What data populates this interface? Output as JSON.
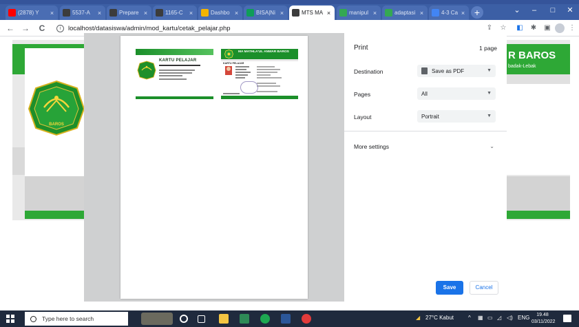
{
  "browser": {
    "tabs": [
      {
        "title": "(2878) Y",
        "favicon_color": "#ff0000",
        "active": false
      },
      {
        "title": "5537-A",
        "favicon_color": "#3c3c3c",
        "active": false
      },
      {
        "title": "Prepare",
        "favicon_color": "#3c3c3c",
        "active": false
      },
      {
        "title": "1165-C",
        "favicon_color": "#3c3c3c",
        "active": false
      },
      {
        "title": "Dashbo",
        "favicon_color": "#f4b400",
        "active": false
      },
      {
        "title": "BISA|Ni",
        "favicon_color": "#0f9d58",
        "active": false
      },
      {
        "title": "MTS MA",
        "favicon_color": "#3c3c3c",
        "active": true
      },
      {
        "title": "manipul",
        "favicon_color": "#34a853",
        "active": false
      },
      {
        "title": "adaptasi",
        "favicon_color": "#34a853",
        "active": false
      },
      {
        "title": "4-3 Car",
        "favicon_color": "#4285f4",
        "active": false
      }
    ],
    "new_tab_symbol": "+",
    "window_controls": {
      "minimize": "–",
      "maximize": "□",
      "close": "✕",
      "tablist": "⌄"
    },
    "address": {
      "url": "localhost/datasiswa/admin/mod_kartu/cetak_pelajar.php"
    },
    "nav": {
      "back": "←",
      "forward": "→",
      "reload": "C"
    }
  },
  "background_page": {
    "header_title": "R BAROS",
    "header_subtitle": "badak-Lebak",
    "logo_text": "BAROS"
  },
  "print_dialog": {
    "title": "Print",
    "page_count": "1 page",
    "destination": {
      "label": "Destination",
      "value": "Save as PDF"
    },
    "pages": {
      "label": "Pages",
      "value": "All"
    },
    "layout": {
      "label": "Layout",
      "value": "Portrait"
    },
    "more_settings": "More settings",
    "save_label": "Save",
    "cancel_label": "Cancel",
    "preview": {
      "front_title": "KARTU PELAJAR",
      "back_header": "MA MATHLA'UL ANWAR BAROS",
      "back_label": "KARTU PELAJAR"
    }
  },
  "taskbar": {
    "search_placeholder": "Type here to search",
    "weather": "27°C  Kabut",
    "language": "ENG",
    "time": "19.48",
    "date": "03/11/2022"
  },
  "colors": {
    "accent_blue": "#1a73e8",
    "brand_green": "#2ea836",
    "tabstrip": "#3c5fa5"
  }
}
